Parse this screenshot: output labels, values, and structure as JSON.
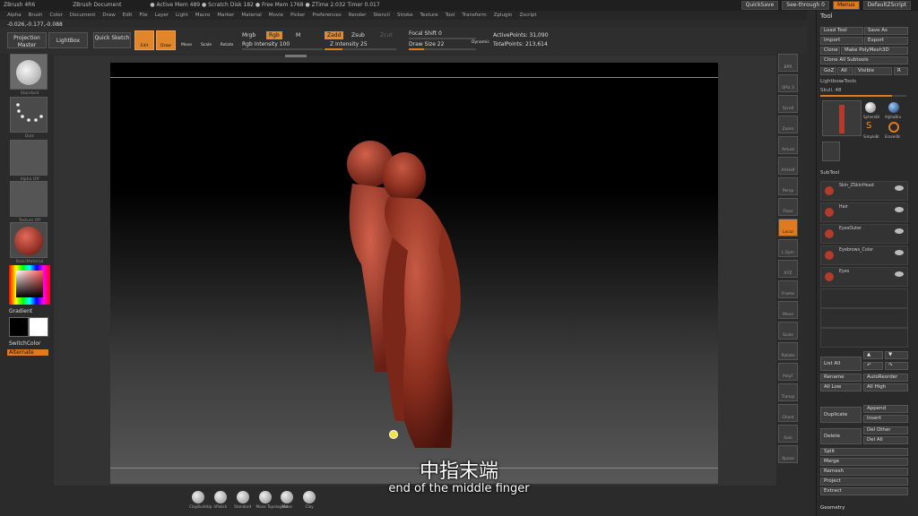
{
  "titlebar": {
    "app": "ZBrush 4R6",
    "doc": "ZBrush Document",
    "stats": "● Active Mem 489 ● Scratch Disk 182 ● Free Mem 1768 ● ZTime 2.032 Timer 0.017",
    "quicksave": "QuickSave",
    "seethrough": "See-through 0",
    "menus": "Menus",
    "script": "DefaultZScript"
  },
  "menubar": [
    "Alpha",
    "Brush",
    "Color",
    "Document",
    "Draw",
    "Edit",
    "File",
    "Layer",
    "Light",
    "Macro",
    "Marker",
    "Material",
    "Movie",
    "Picker",
    "Preferences",
    "Render",
    "Stencil",
    "Stroke",
    "Texture",
    "Tool",
    "Transform",
    "Zplugin",
    "Zscript"
  ],
  "coords": "-0.026,-0.177,-0.088",
  "toolbar": {
    "projection_master": "Projection Master",
    "lightbox": "LightBox",
    "quick_sketch": "Quick Sketch",
    "edit": "Edit",
    "draw": "Draw",
    "move": "Move",
    "scale": "Scale",
    "rotate": "Rotate",
    "mrgb": "Mrgb",
    "rgb": "Rgb",
    "m": "M",
    "rgb_intensity": "Rgb Intensity 100",
    "zadd": "Zadd",
    "zsub": "Zsub",
    "zcut": "Zcut",
    "z_intensity": "Z Intensity 25",
    "focal_shift": "Focal Shift 0",
    "draw_size": "Draw Size 22",
    "dynamic": "Dynamic",
    "active_points": "ActivePoints: 31,090",
    "total_points": "TotalPoints: 213,614"
  },
  "leftshelf": {
    "brush": "Standard",
    "stroke": "Dots",
    "alpha": "Alpha Off",
    "texture": "Texture Off",
    "material": "BasicMaterial",
    "gradient": "Gradient",
    "switchcolor": "SwitchColor",
    "alternate": "Alternate"
  },
  "rightshelf": [
    "BPR",
    "SPix 3",
    "Scroll",
    "Zoom",
    "Actual",
    "AAHalf",
    "Persp",
    "Floor",
    "Local",
    "L.Sym",
    "XYZ",
    "Frame",
    "Move",
    "Scale",
    "Rotate",
    "PolyF",
    "Transp",
    "Ghost",
    "Solo",
    "Xpose"
  ],
  "toolpanel": {
    "title": "Tool",
    "load_tool": "Load Tool",
    "save_as": "Save As",
    "import": "Import",
    "export": "Export",
    "clone": "Clone",
    "make_polymesh": "Make PolyMesh3D",
    "clone_all": "Clone All Subtools",
    "goz": "GoZ",
    "all": "All",
    "visible": "Visible",
    "r": "R",
    "lightbox_tools": "Lightbox▸Tools",
    "skull": "Skull. 48",
    "sphere": "SphereBr",
    "alphabrush": "AlphaBru",
    "simplebrush": "SimpleBr",
    "eraserbrush": "EraserBr",
    "subtool": "SubTool",
    "subtools": [
      "Skin_ZSkinHead",
      "Hair",
      "EyesOuter",
      "Eyebrows_Color",
      "Eyes"
    ],
    "list_all": "List All",
    "rename": "Rename",
    "autoreorder": "AutoReorder",
    "all_low": "All Low",
    "all_high": "All High",
    "duplicate": "Duplicate",
    "append": "Append",
    "insert": "Insert",
    "delete": "Delete",
    "del_other": "Del Other",
    "del_all": "Del All",
    "split": "Split",
    "merge": "Merge",
    "remesh": "Remesh",
    "project": "Project",
    "extract": "Extract",
    "geometry": "Geometry"
  },
  "bottomtray": [
    "ClayBuildUp",
    "hPolish",
    "Standard",
    "Move Topological",
    "Move",
    "Clay"
  ],
  "subtitle": {
    "cn": "中指末端",
    "en": "end of the middle finger"
  }
}
